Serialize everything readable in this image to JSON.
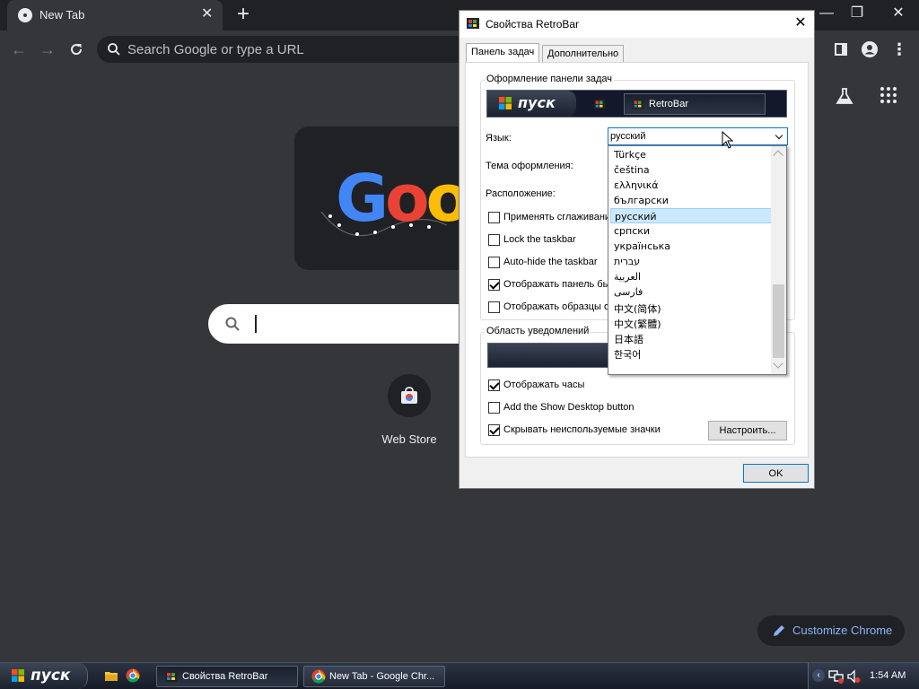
{
  "browser": {
    "tab_title": "New Tab",
    "omnibox_placeholder": "Search Google or type a URL",
    "shortcut_label": "Web Store",
    "customize_label": "Customize Chrome",
    "doodle_text": "Goog"
  },
  "dialog": {
    "title": "Свойства RetroBar",
    "tabs": [
      "Панель задач",
      "Дополнительно"
    ],
    "group_taskbar_label": "Оформление панели задач",
    "preview_start_label": "пуск",
    "preview_task_label": "RetroBar",
    "language_label": "Язык:",
    "theme_label": "Тема оформления:",
    "position_label": "Расположение:",
    "language_value": "русский",
    "checkboxes": [
      {
        "label": "Применять сглаживани",
        "checked": false
      },
      {
        "label": "Lock the taskbar",
        "checked": false
      },
      {
        "label": "Auto-hide the taskbar",
        "checked": false
      },
      {
        "label": "Отображать панель бы",
        "checked": true
      },
      {
        "label": "Отображать образцы о",
        "checked": false
      }
    ],
    "group_tray_label": "Область уведомлений",
    "tray_checkboxes": [
      {
        "label": "Отображать часы",
        "checked": true
      },
      {
        "label": "Add the Show Desktop button",
        "checked": false
      },
      {
        "label": "Скрывать неиспользуемые значки",
        "checked": true
      }
    ],
    "configure_button": "Настроить...",
    "ok_button": "OK",
    "language_options": [
      "Türkçe",
      "čeština",
      "ελληνικά",
      "български",
      "русский",
      "српски",
      "українська",
      "עברית",
      "العربية",
      "فارسی",
      "中文(简体)",
      "中文(繁體)",
      "日本語",
      "한국어"
    ],
    "selected_language_index": 4
  },
  "taskbar": {
    "start_label": "пуск",
    "task_buttons": [
      "Свойства RetroBar",
      "New Tab - Google Chr..."
    ],
    "clock": "1:54 AM"
  },
  "colors": {
    "chrome_bg": "#35363a",
    "chrome_dark": "#202124",
    "accent_blue": "#8ab4f8",
    "selection": "#cce8ff"
  }
}
